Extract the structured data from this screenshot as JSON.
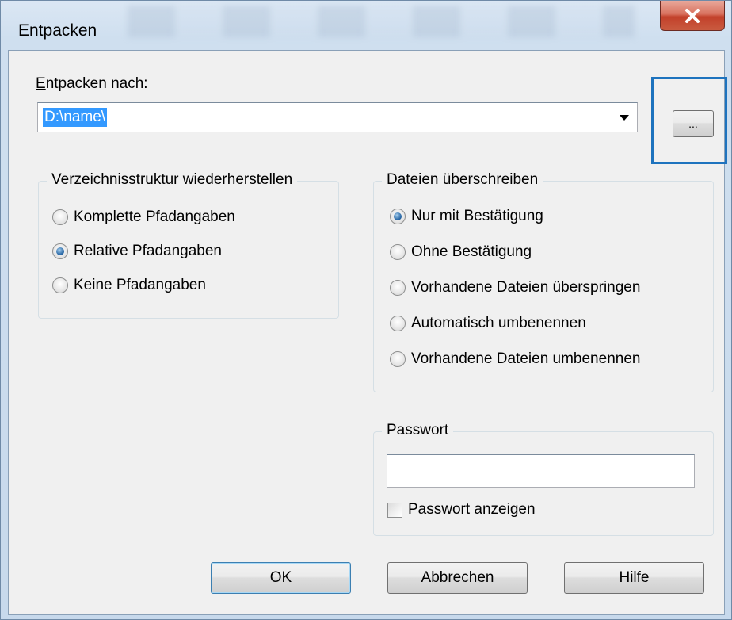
{
  "window": {
    "title": "Entpacken",
    "close_icon": "close-icon"
  },
  "destination": {
    "label_prefix": "",
    "label_accel": "E",
    "label_rest": "ntpacken nach:",
    "value": "D:\\name\\",
    "browse_label": "..."
  },
  "structure_group": {
    "title": "Verzeichnisstruktur wiederherstellen",
    "options": [
      {
        "label": "Komplette Pfadangaben",
        "selected": false
      },
      {
        "label": "Relative Pfadangaben",
        "selected": true
      },
      {
        "label": "Keine Pfadangaben",
        "selected": false
      }
    ]
  },
  "overwrite_group": {
    "title": "Dateien überschreiben",
    "options": [
      {
        "label": "Nur mit Bestätigung",
        "selected": true
      },
      {
        "label": "Ohne Bestätigung",
        "selected": false
      },
      {
        "label": "Vorhandene Dateien überspringen",
        "selected": false
      },
      {
        "label": "Automatisch umbenennen",
        "selected": false
      },
      {
        "label": "Vorhandene Dateien umbenennen",
        "selected": false
      }
    ]
  },
  "password_group": {
    "title": "Passwort",
    "value": "",
    "show_label_pre": "Passwort an",
    "show_label_accel": "z",
    "show_label_post": "eigen",
    "show_checked": false
  },
  "buttons": {
    "ok": "OK",
    "cancel": "Abbrechen",
    "help": "Hilfe"
  },
  "colors": {
    "selection": "#3399ff",
    "highlight_border": "#1e73be",
    "close_red": "#c2402a"
  }
}
